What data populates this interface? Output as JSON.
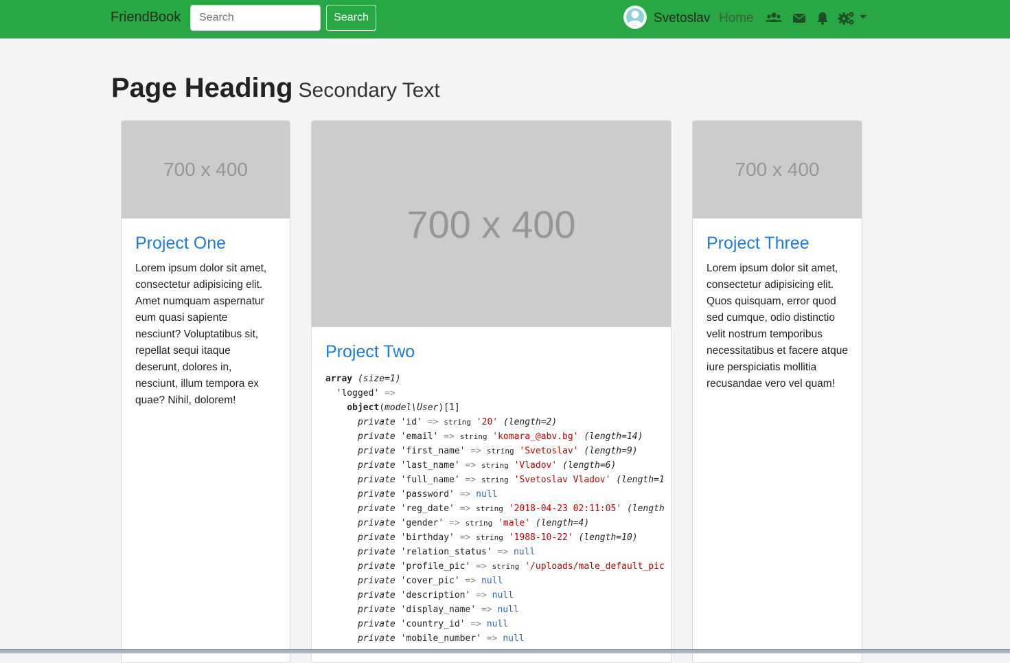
{
  "navbar": {
    "brand": "FriendBook",
    "search_placeholder": "Search",
    "search_button": "Search",
    "username": "Svetoslav",
    "home": "Home",
    "bg_color": "#28a745",
    "icons": [
      "avatar-icon",
      "users-icon",
      "envelope-icon",
      "bell-icon",
      "cogs-icon",
      "caret-down-icon"
    ]
  },
  "heading": {
    "main": "Page Heading",
    "secondary": "Secondary Text"
  },
  "cards": [
    {
      "image_label": "700 x 400",
      "title": "Project One",
      "text": "Lorem ipsum dolor sit amet, consectetur adipisicing elit. Amet numquam aspernatur eum quasi sapiente nesciunt? Voluptatibus sit, repellat sequi itaque deserunt, dolores in, nesciunt, illum tempora ex quae? Nihil, dolorem!"
    },
    {
      "image_label": "700 x 400",
      "title": "Project Two",
      "dump": {
        "header_type": "array",
        "header_size": "(size=1)",
        "key": "'logged'",
        "object_type": "object",
        "object_class": "(model\\User)[1]",
        "props": [
          {
            "name": "'id'",
            "type": "string",
            "value": "'20'",
            "len": "(length=2)"
          },
          {
            "name": "'email'",
            "type": "string",
            "value": "'komara_@abv.bg'",
            "len": "(length=14)"
          },
          {
            "name": "'first_name'",
            "type": "string",
            "value": "'Svetoslav'",
            "len": "(length=9)"
          },
          {
            "name": "'last_name'",
            "type": "string",
            "value": "'Vladov'",
            "len": "(length=6)"
          },
          {
            "name": "'full_name'",
            "type": "string",
            "value": "'Svetoslav Vladov'",
            "len": "(length=1"
          },
          {
            "name": "'password'",
            "type": "",
            "value": "null",
            "len": ""
          },
          {
            "name": "'reg_date'",
            "type": "string",
            "value": "'2018-04-23 02:11:05'",
            "len": "(length"
          },
          {
            "name": "'gender'",
            "type": "string",
            "value": "'male'",
            "len": "(length=4)"
          },
          {
            "name": "'birthday'",
            "type": "string",
            "value": "'1988-10-22'",
            "len": "(length=10)"
          },
          {
            "name": "'relation_status'",
            "type": "",
            "value": "null",
            "len": ""
          },
          {
            "name": "'profile_pic'",
            "type": "string",
            "value": "'/uploads/male_default_pic",
            "len": ""
          },
          {
            "name": "'cover_pic'",
            "type": "",
            "value": "null",
            "len": ""
          },
          {
            "name": "'description'",
            "type": "",
            "value": "null",
            "len": ""
          },
          {
            "name": "'display_name'",
            "type": "",
            "value": "null",
            "len": ""
          },
          {
            "name": "'country_id'",
            "type": "",
            "value": "null",
            "len": ""
          },
          {
            "name": "'mobile_number'",
            "type": "",
            "value": "null",
            "len": ""
          }
        ]
      }
    },
    {
      "image_label": "700 x 400",
      "title": "Project Three",
      "text": "Lorem ipsum dolor sit amet, consectetur adipisicing elit. Quos quisquam, error quod sed cumque, odio distinctio velit nostrum temporibus necessitatibus et facere atque iure perspiciatis mollitia recusandae vero vel quam!"
    }
  ]
}
